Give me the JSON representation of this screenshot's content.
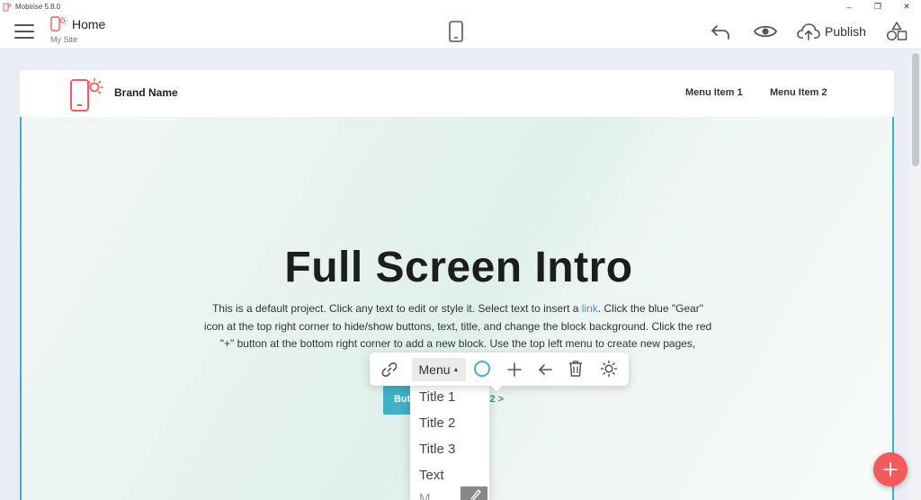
{
  "window": {
    "title": "Mobirise 5.8.0",
    "controls": [
      "–",
      "❐",
      "✕"
    ]
  },
  "appbar": {
    "page_title": "Home",
    "site_name": "My Site",
    "publish_label": "Publish"
  },
  "site": {
    "brand_name": "Brand Name",
    "nav_items": [
      "Menu Item 1",
      "Menu Item 2"
    ],
    "hero_title": "Full Screen Intro",
    "hero_text_before_link": "This is a default project. Click any text to edit or style it. Select text to insert a ",
    "hero_link": "link",
    "hero_text_after_link": ". Click the blue \"Gear\" icon at the top right corner to hide/show buttons, text, title, and change the block background. Click the red \"+\" button at the bottom right corner to add a new block. Use the top left menu to create new pages,",
    "button_primary": "Butt",
    "button_secondary": "on 2 >"
  },
  "text_toolbar": {
    "menu_label": "Menu",
    "menu_caret": "▲",
    "accent": "#3fb2c6"
  },
  "dropdown": {
    "items": [
      "Title 1",
      "Title 2",
      "Title 3",
      "Text",
      "M..."
    ]
  },
  "colors": {
    "accent": "#3fb2c6",
    "fab": "#f55a5a",
    "brand_logo": "#f55a5a"
  },
  "icons": [
    "hamburger-icon",
    "page-icon",
    "mobile-device-icon",
    "undo-icon",
    "preview-eye-icon",
    "cloud-upload-icon",
    "blocks-icon",
    "link-icon",
    "circle-icon",
    "plus-icon",
    "arrow-left-icon",
    "trash-icon",
    "gear-icon",
    "add-block-icon"
  ]
}
